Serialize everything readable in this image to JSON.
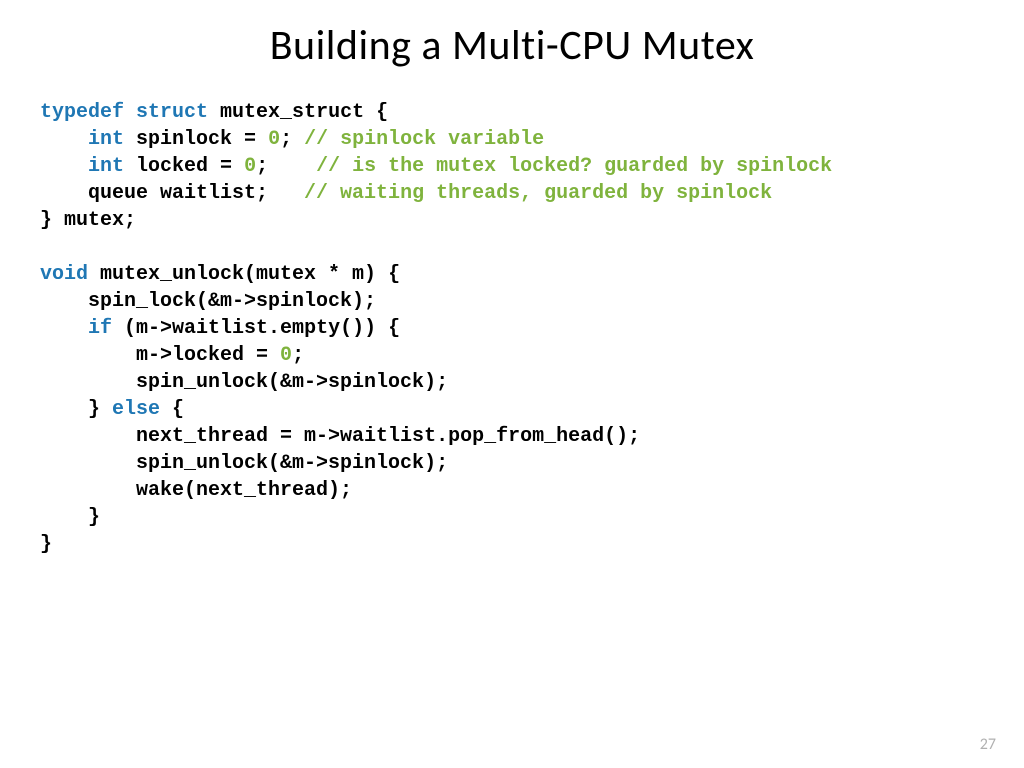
{
  "slide": {
    "title": "Building a Multi-CPU Mutex",
    "page_number": "27",
    "code": {
      "l1_a": "typedef",
      "l1_b": "struct",
      "l1_c": " mutex_struct {",
      "l2_a": "    ",
      "l2_b": "int",
      "l2_c": " spinlock = ",
      "l2_d": "0",
      "l2_e": "; ",
      "l2_f": "// spinlock variable",
      "l3_a": "    ",
      "l3_b": "int",
      "l3_c": " locked = ",
      "l3_d": "0",
      "l3_e": ";    ",
      "l3_f": "// is the mutex locked? guarded by spinlock",
      "l4_a": "    queue waitlist;   ",
      "l4_b": "// waiting threads, guarded by spinlock",
      "l5": "} mutex;",
      "l6": "",
      "l7_a": "void",
      "l7_b": " mutex_unlock(mutex * m) {",
      "l8": "    spin_lock(&m->spinlock);",
      "l9_a": "    ",
      "l9_b": "if",
      "l9_c": " (m->waitlist.empty()) {",
      "l10_a": "        m->locked = ",
      "l10_b": "0",
      "l10_c": ";",
      "l11": "        spin_unlock(&m->spinlock);",
      "l12_a": "    } ",
      "l12_b": "else",
      "l12_c": " {",
      "l13": "        next_thread = m->waitlist.pop_from_head();",
      "l14": "        spin_unlock(&m->spinlock);",
      "l15": "        wake(next_thread);",
      "l16": "    }",
      "l17": "}"
    }
  }
}
